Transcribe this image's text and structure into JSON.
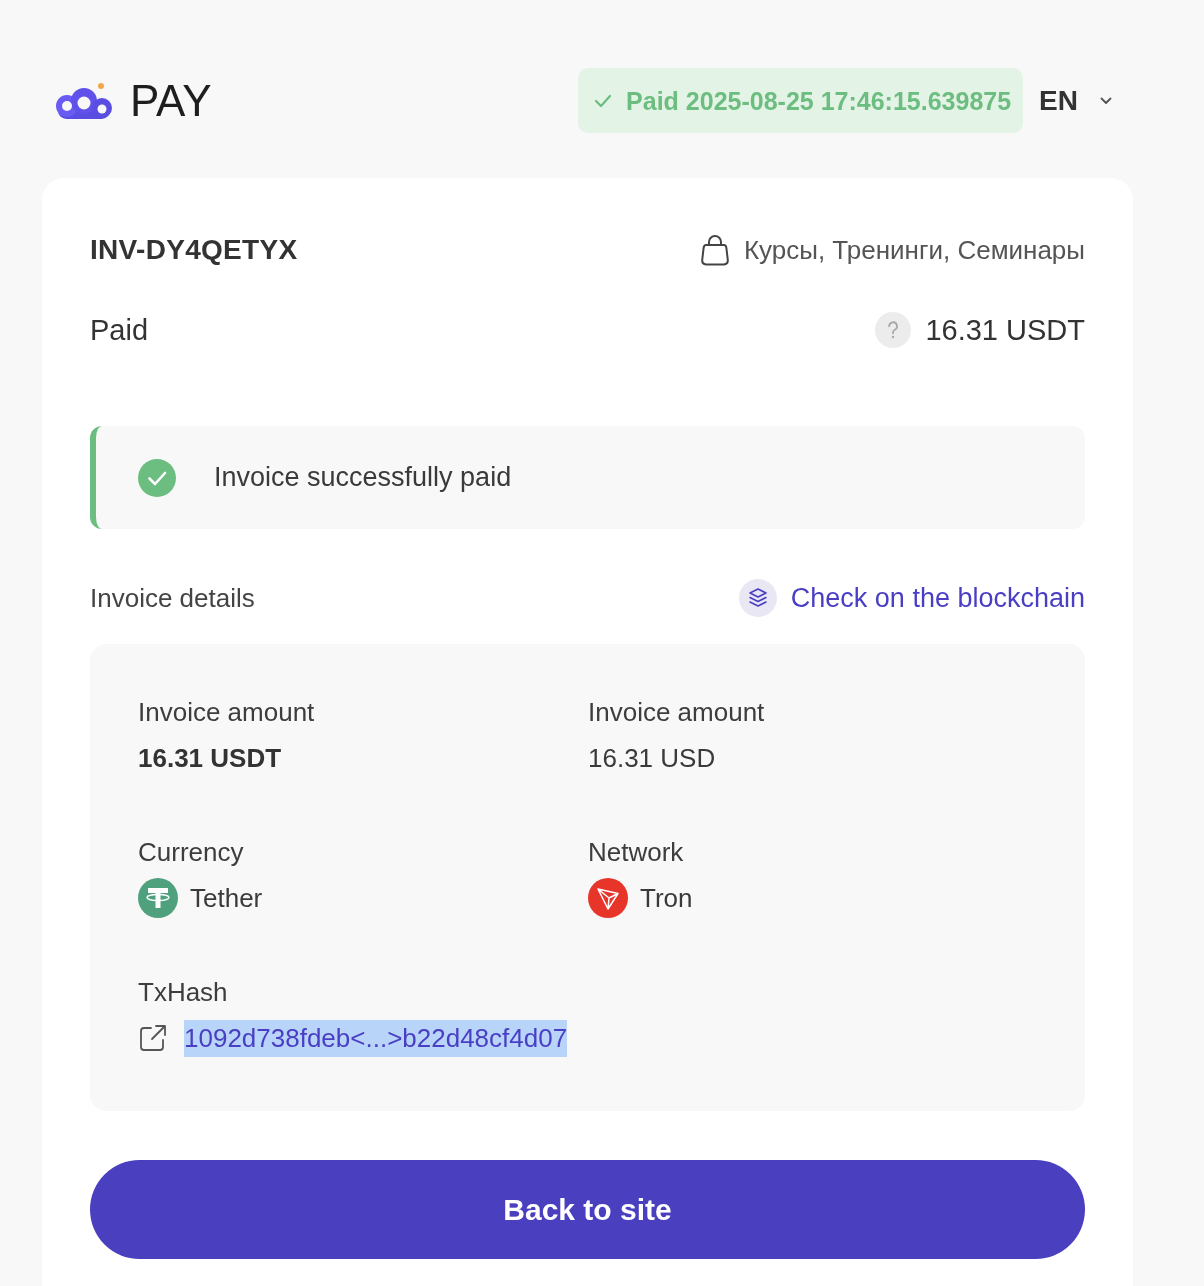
{
  "header": {
    "logo_text": "PAY",
    "status": {
      "kind": "paid",
      "label": "Paid 2025-08-25 17:46:15.639875"
    },
    "language": {
      "code": "EN"
    }
  },
  "invoice": {
    "id": "INV-DY4QETYX",
    "category": "Курсы, Тренинги, Семинары",
    "status": "Paid",
    "amount": "16.31 USDT"
  },
  "alert": {
    "kind": "success",
    "message": "Invoice successfully paid"
  },
  "details": {
    "title": "Invoice details",
    "blockchain_link": "Check on the blockchain",
    "fields": [
      {
        "kind": "amount",
        "label": "Invoice amount",
        "value": "16.31 USDT",
        "bold": true
      },
      {
        "kind": "amount",
        "label": "Invoice amount",
        "value": "16.31 USD",
        "bold": false
      },
      {
        "kind": "currency",
        "label": "Currency",
        "value": "Tether"
      },
      {
        "kind": "network",
        "label": "Network",
        "value": "Tron"
      },
      {
        "kind": "hash",
        "label": "TxHash",
        "value": "1092d738fdeb<...>b22d48cf4d07",
        "highlighted": true
      }
    ]
  },
  "button": {
    "label": "Back to site"
  }
}
